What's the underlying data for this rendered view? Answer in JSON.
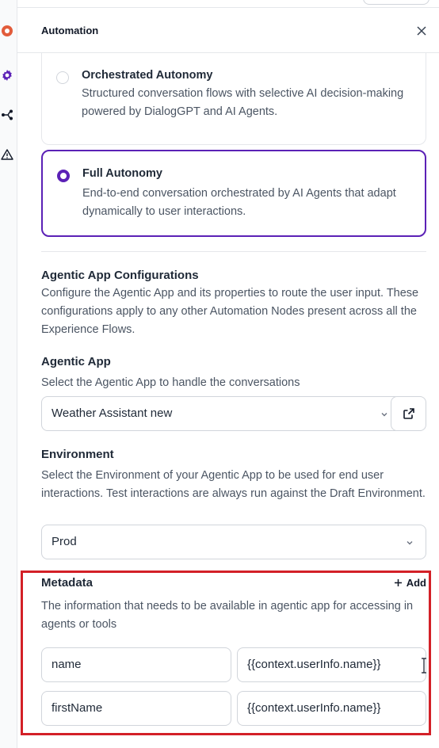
{
  "rail": {
    "icons": [
      "app-icon",
      "gear-icon",
      "flow-icon",
      "warning-icon"
    ],
    "colors": {
      "app": "#e25c3b",
      "gear": "#5b21b6",
      "flow": "#111827"
    }
  },
  "panel": {
    "title": "Automation",
    "close_label": "×"
  },
  "modes": [
    {
      "title": "Orchestrated Autonomy",
      "description": "Structured conversation flows with selective AI decision-making powered by DialogGPT and AI Agents.",
      "selected": false
    },
    {
      "title": "Full Autonomy",
      "description": "End-to-end conversation orchestrated by AI Agents that adapt dynamically to user interactions.",
      "selected": true
    }
  ],
  "config": {
    "title": "Agentic App Configurations",
    "description": "Configure the Agentic App and its properties to route the user input. These configurations apply to any other Automation Nodes present across all the Experience Flows."
  },
  "agentic_app": {
    "label": "Agentic App",
    "description": "Select the Agentic App to handle the conversations",
    "value": "Weather Assistant new",
    "open_icon": "external-link-icon"
  },
  "environment": {
    "label": "Environment",
    "description": "Select the Environment of your Agentic App to be used for end user interactions. Test interactions are always run against the Draft Environment.",
    "value": "Prod"
  },
  "metadata": {
    "label": "Metadata",
    "add_label": "Add",
    "description": "The information that needs to be available in agentic app for accessing in agents or tools",
    "rows": [
      {
        "key": "name",
        "value": "{{context.userInfo.name}}"
      },
      {
        "key": "firstName",
        "value": "{{context.userInfo.name}}"
      }
    ]
  },
  "accent_color": "#5b21b6",
  "highlight_color": "#d32027"
}
